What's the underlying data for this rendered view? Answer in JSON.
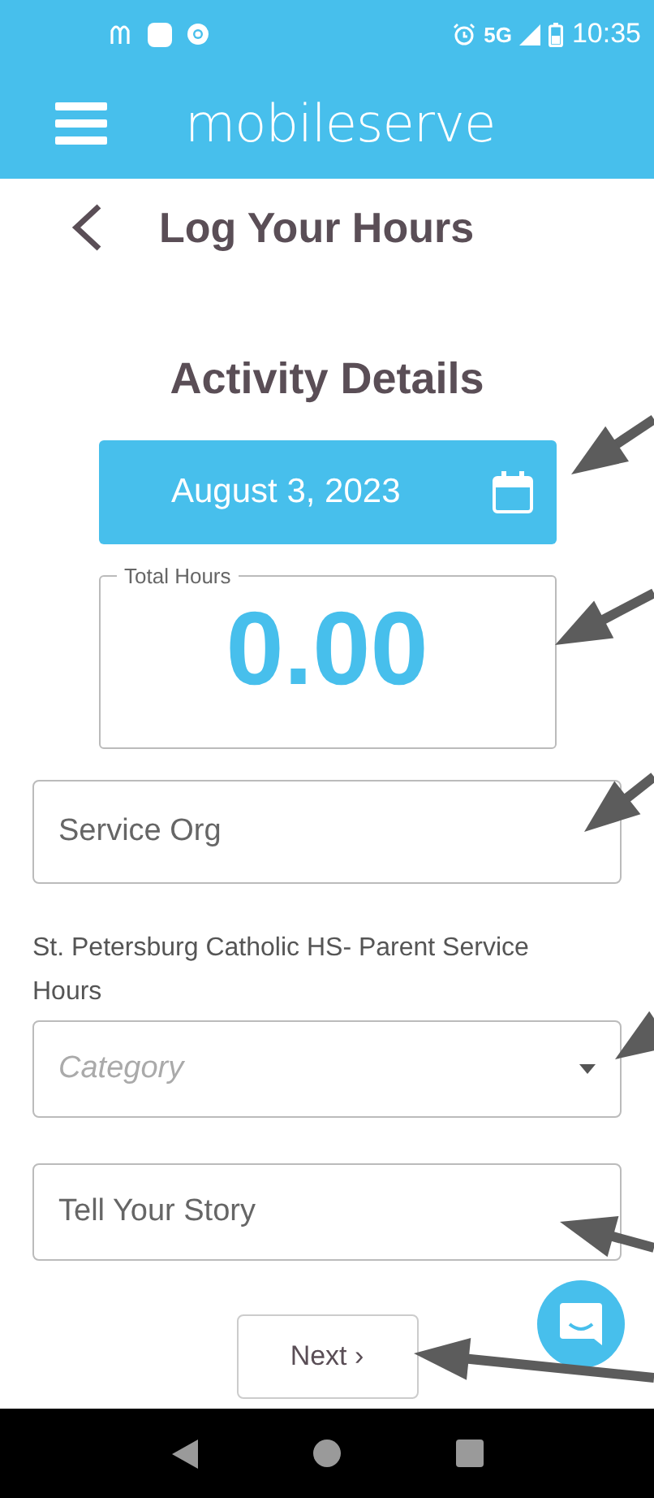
{
  "status_bar": {
    "network": "5G",
    "time": "10:35"
  },
  "app_bar": {
    "brand": "mobileserve"
  },
  "page_title": "Log Your Hours",
  "section_title": "Activity Details",
  "date_button": "August 3, 2023",
  "total_hours": {
    "label": "Total Hours",
    "value": "0.00"
  },
  "service_org": {
    "placeholder": "Service Org"
  },
  "organization": "St. Petersburg Catholic HS- Parent Service Hours",
  "category": {
    "placeholder": "Category"
  },
  "story": {
    "placeholder": "Tell Your Story"
  },
  "next_button": "Next ›"
}
